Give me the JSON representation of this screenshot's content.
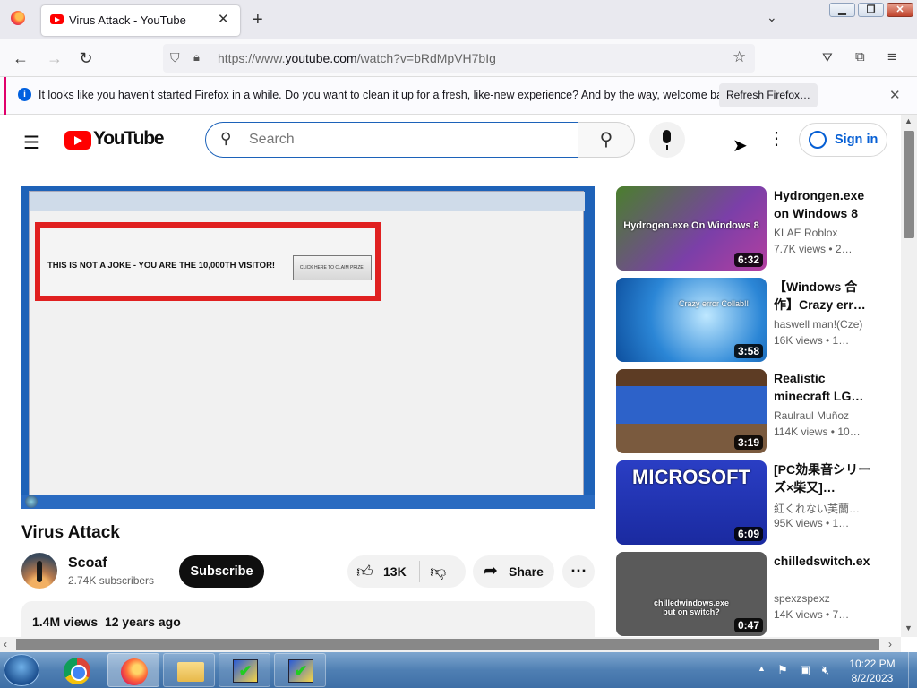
{
  "browser": {
    "tab_title": "Virus Attack - YouTube",
    "url_prefix": "https://www.",
    "url_domain": "youtube.com",
    "url_path": "/watch?v=bRdMpVH7bIg",
    "notification_text": "It looks like you haven’t started Firefox in a while. Do you want to clean it up for a fresh, like-new experience? And by the way, welcome back!",
    "notification_button": "Refresh Firefox…"
  },
  "youtube": {
    "logo_text": "YouTube",
    "search_placeholder": "Search",
    "signin_label": "Sign in"
  },
  "video": {
    "title": "Virus Attack",
    "frame_text": "THIS IS NOT A JOKE - YOU ARE THE 10,000TH VISITOR!",
    "frame_button": "CLICK HERE TO CLAIM PRIZE!",
    "channel": "Scoaf",
    "subscribers": "2.74K subscribers",
    "subscribe_label": "Subscribe",
    "likes": "13K",
    "share_label": "Share",
    "views": "1.4M views",
    "age": "12 years ago"
  },
  "recommendations": [
    {
      "title": "Hydrongen.exe on Windows 8",
      "channel": "KLAE Roblox",
      "views": "7.7K views • 2…",
      "duration": "6:32",
      "thumb_text": "Hydrogen.exe On Windows 8",
      "thumb_bg": "linear-gradient(135deg,#4a7f2c,#7b3fa8 60%,#b33fa0)"
    },
    {
      "title": "【Windows 合作】Crazy err…",
      "channel": "haswell man!(Cze)",
      "views": "16K views • 1…",
      "duration": "3:58",
      "thumb_text": "Crazy error Collab!!",
      "thumb_bg": "radial-gradient(circle at 60% 45%,#bfe8ff,#2b86d6 55%,#0d4f9e)"
    },
    {
      "title": "Realistic minecraft LG…",
      "channel": "Raulraul Muñoz",
      "views": "114K views • 10…",
      "duration": "3:19",
      "thumb_text": "",
      "thumb_bg": "linear-gradient(#5d3c24 0 20%,#2d62c9 20% 65%,#7a5a3e 65%)"
    },
    {
      "title": "[PC効果音シリーズ×柴又]…",
      "channel": "紅くれない芙蘭…",
      "views": "95K views • 1…",
      "duration": "6:09",
      "thumb_text": "MICROSOFT",
      "thumb_bg": "linear-gradient(#2a3ec4,#1a2aa0)"
    },
    {
      "title": "chilledswitch.ex",
      "channel": "spexzspexz",
      "views": "14K views • 7…",
      "duration": "0:47",
      "thumb_text": "chilledwindows.exe but on switch?",
      "thumb_bg": "#5a5a5a"
    }
  ],
  "taskbar": {
    "time": "10:22 PM",
    "date": "8/2/2023"
  }
}
